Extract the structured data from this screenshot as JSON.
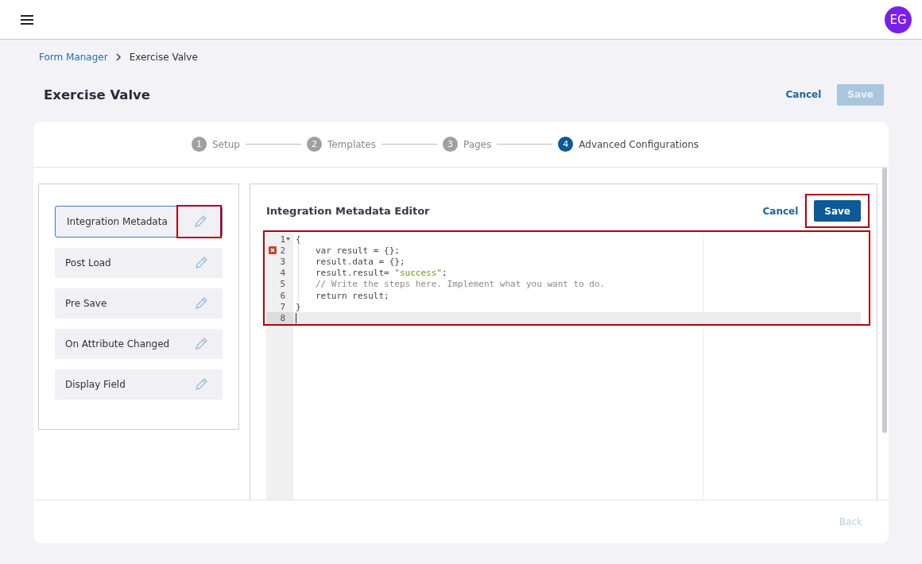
{
  "header": {
    "avatar": "EG"
  },
  "breadcrumb": [
    {
      "label": "Form Manager",
      "link": true
    },
    {
      "label": "Exercise Valve",
      "link": false
    }
  ],
  "page": {
    "title": "Exercise Valve",
    "actions": [
      {
        "label": "Cancel",
        "kind": "link",
        "disabled": false
      },
      {
        "label": "Save",
        "kind": "primary",
        "disabled": true
      }
    ]
  },
  "steps": [
    {
      "number": "1",
      "label": "Setup",
      "selected": false
    },
    {
      "number": "2",
      "label": "Templates",
      "selected": false
    },
    {
      "number": "3",
      "label": "Pages",
      "selected": false
    },
    {
      "number": "4",
      "label": "Advanced Configurations",
      "selected": true
    }
  ],
  "sidebar": {
    "items": [
      {
        "label": "Integration Metadata",
        "selected": true,
        "highlighted": true
      },
      {
        "label": "Post Load",
        "selected": false,
        "highlighted": false
      },
      {
        "label": "Pre Save",
        "selected": false,
        "highlighted": false
      },
      {
        "label": "On Attribute Changed",
        "selected": false,
        "highlighted": false
      },
      {
        "label": "Display Field",
        "selected": false,
        "highlighted": false
      }
    ]
  },
  "editor": {
    "title": "Integration Metadata Editor",
    "actions": [
      {
        "label": "Cancel",
        "kind": "link",
        "highlighted": false
      },
      {
        "label": "Save",
        "kind": "primary",
        "highlighted": true
      }
    ],
    "highlighted": true,
    "lines": [
      {
        "number": "1",
        "foldable": true,
        "error": false,
        "indented": false,
        "active": false,
        "tokens": [
          {
            "kind": "plain",
            "text": "{"
          }
        ]
      },
      {
        "number": "2",
        "foldable": false,
        "error": true,
        "indented": true,
        "active": false,
        "tokens": [
          {
            "kind": "plain",
            "text": "var result = {};"
          }
        ]
      },
      {
        "number": "3",
        "foldable": false,
        "error": false,
        "indented": true,
        "active": false,
        "tokens": [
          {
            "kind": "plain",
            "text": "result.data = {};"
          }
        ]
      },
      {
        "number": "4",
        "foldable": false,
        "error": false,
        "indented": true,
        "active": false,
        "tokens": [
          {
            "kind": "plain",
            "text": "result.result= "
          },
          {
            "kind": "string",
            "text": "\"success\""
          },
          {
            "kind": "plain",
            "text": ";"
          }
        ]
      },
      {
        "number": "5",
        "foldable": false,
        "error": false,
        "indented": true,
        "active": false,
        "tokens": [
          {
            "kind": "comment",
            "text": "// Write the steps here. Implement what you want to do."
          }
        ]
      },
      {
        "number": "6",
        "foldable": false,
        "error": false,
        "indented": true,
        "active": false,
        "tokens": [
          {
            "kind": "plain",
            "text": "return result;"
          }
        ]
      },
      {
        "number": "7",
        "foldable": false,
        "error": false,
        "indented": false,
        "active": false,
        "tokens": [
          {
            "kind": "plain",
            "text": "}"
          }
        ]
      },
      {
        "number": "8",
        "foldable": false,
        "error": false,
        "indented": false,
        "active": true
      }
    ]
  },
  "footer": {
    "back": {
      "label": "Back",
      "disabled": true
    }
  }
}
